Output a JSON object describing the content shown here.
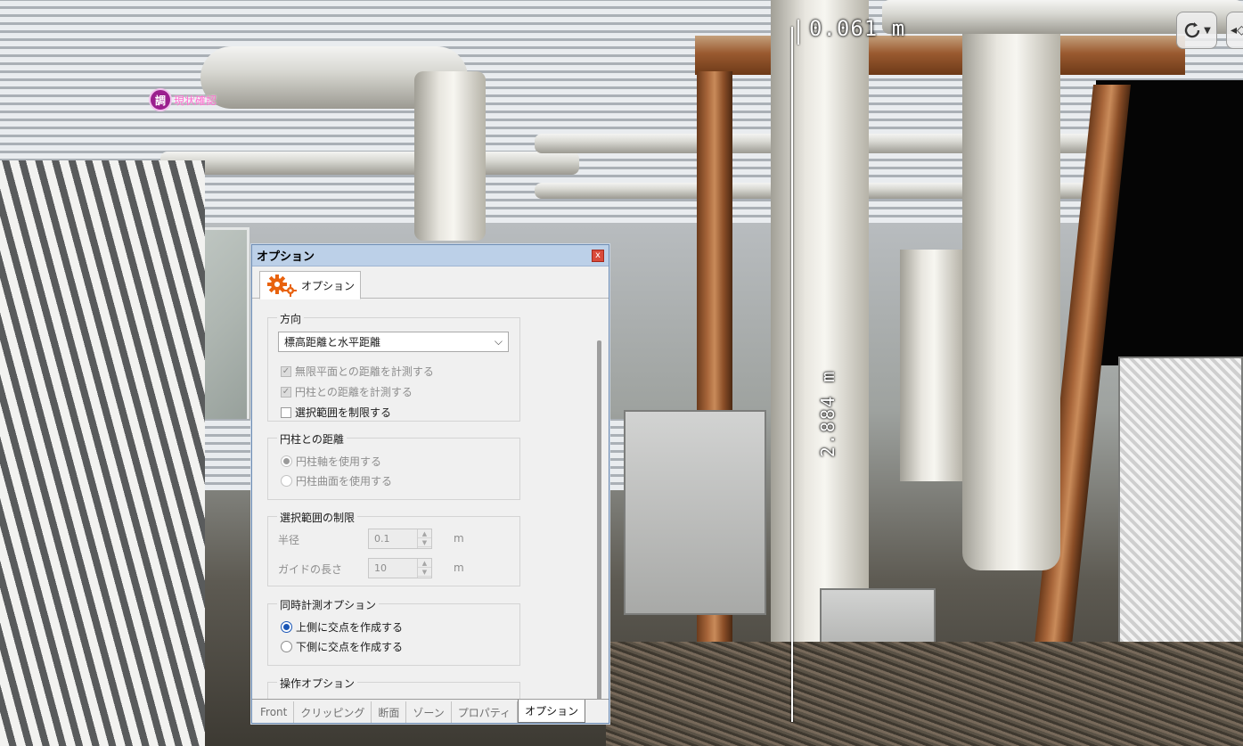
{
  "scene": {
    "measurement_top": "0.061 m",
    "measurement_vertical": "2.884 m",
    "pin_badge": "調",
    "pin_label": "現状確認"
  },
  "nav": {
    "orbit_icon": "orbit-icon",
    "second_icon": "nav-arrows-icon"
  },
  "panel": {
    "title": "オプション",
    "close_glyph": "x",
    "tab_label": "オプション",
    "groups": {
      "direction": {
        "title": "方向",
        "select_value": "標高距離と水平距離",
        "checks": [
          {
            "label": "無限平面との距離を計測する"
          },
          {
            "label": "円柱との距離を計測する"
          },
          {
            "label": "選択範囲を制限する"
          }
        ]
      },
      "cylinder": {
        "title": "円柱との距離",
        "radios": [
          {
            "label": "円柱軸を使用する"
          },
          {
            "label": "円柱曲面を使用する"
          }
        ]
      },
      "selection_limit": {
        "title": "選択範囲の制限",
        "radius_label": "半径",
        "radius_value": "0.1",
        "radius_unit": "m",
        "guide_label": "ガイドの長さ",
        "guide_value": "10",
        "guide_unit": "m"
      },
      "simultaneous": {
        "title": "同時計測オプション",
        "radios": [
          {
            "label": "上側に交点を作成する"
          },
          {
            "label": "下側に交点を作成する"
          }
        ]
      },
      "operation": {
        "title": "操作オプション"
      }
    },
    "bottom_tabs": [
      {
        "label": "Front"
      },
      {
        "label": "クリッピング"
      },
      {
        "label": "断面"
      },
      {
        "label": "ゾーン"
      },
      {
        "label": "プロパティ"
      },
      {
        "label": "オプション"
      }
    ]
  }
}
